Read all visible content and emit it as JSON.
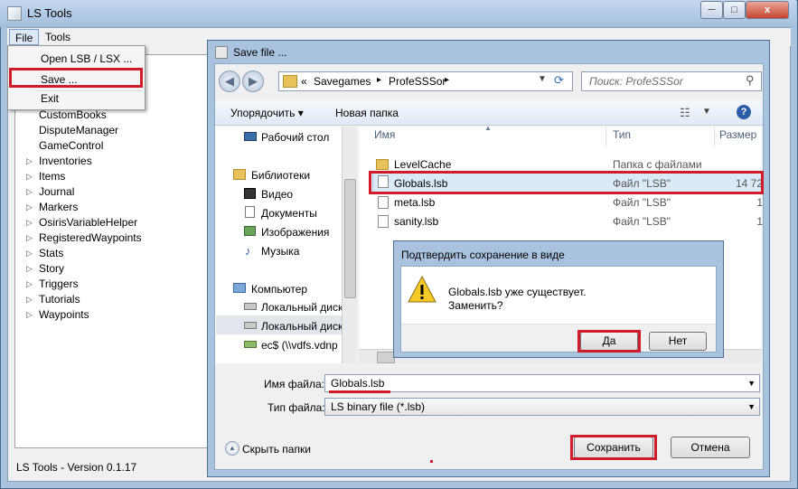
{
  "app": {
    "title": "LS Tools",
    "status": "LS Tools - Version 0.1.17"
  },
  "window_controls": {
    "minimize": "─",
    "maximize": "□",
    "close": "x"
  },
  "menu": {
    "file": "File",
    "tools": "Tools"
  },
  "file_menu": {
    "open": "Open LSB / LSX ...",
    "save": "Save ...",
    "exit": "Exit"
  },
  "tree": [
    "CustomBooks",
    "DisputeManager",
    "GameControl",
    "Inventories",
    "Items",
    "Journal",
    "Markers",
    "OsirisVariableHelper",
    "RegisteredWaypoints",
    "Stats",
    "Story",
    "Triggers",
    "Tutorials",
    "Waypoints"
  ],
  "save_dialog": {
    "title": "Save file ...",
    "breadcrumb": {
      "prefix": "«",
      "seg1": "Savegames",
      "sep": "▸",
      "seg2": "ProfeSSSor"
    },
    "search_placeholder": "Поиск: ProfeSSSor",
    "organize": "Упорядочить ▾",
    "new_folder": "Новая папка",
    "nav": {
      "desktop": "Рабочий стол",
      "libraries": "Библиотеки",
      "video": "Видео",
      "documents": "Документы",
      "images": "Изображения",
      "music": "Музыка",
      "computer": "Компьютер",
      "disk1": "Локальный диск",
      "disk2": "Локальный диск",
      "network": "ec$ (\\\\vdfs.vdnp"
    },
    "columns": {
      "name": "Имя",
      "type": "Тип",
      "size": "Размер"
    },
    "files": [
      {
        "name": "LevelCache",
        "type": "Папка с файлами",
        "size": ""
      },
      {
        "name": "Globals.lsb",
        "type": "Файл \"LSB\"",
        "size": "14 72"
      },
      {
        "name": "meta.lsb",
        "type": "Файл \"LSB\"",
        "size": "1"
      },
      {
        "name": "sanity.lsb",
        "type": "Файл \"LSB\"",
        "size": "1"
      }
    ],
    "filename_label": "Имя файла:",
    "filename_value": "Globals.lsb",
    "filetype_label": "Тип файла:",
    "filetype_value": "LS binary file (*.lsb)",
    "hide_folders": "Скрыть папки",
    "save_button": "Сохранить",
    "cancel_button": "Отмена"
  },
  "confirm": {
    "title": "Подтвердить сохранение в виде",
    "line1": "Globals.lsb уже существует.",
    "line2": "Заменить?",
    "yes": "Да",
    "no": "Нет"
  },
  "colors": {
    "highlight_red": "#d01c2a",
    "frame_blue": "#a9c3df"
  }
}
